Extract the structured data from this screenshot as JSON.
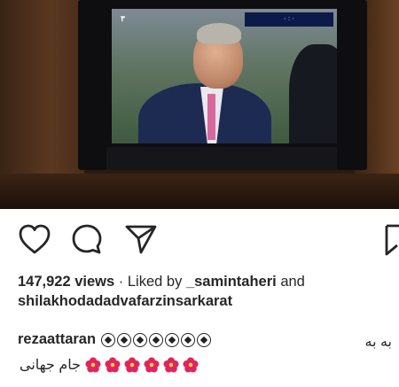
{
  "post": {
    "tv": {
      "channel_logo": "۳",
      "score": "۰ : ۰"
    },
    "actions": {
      "like_icon": "heart-icon",
      "comment_icon": "comment-icon",
      "share_icon": "share-icon",
      "save_icon": "bookmark-icon"
    },
    "views": "147,922 views",
    "liked_by_text": "Liked by",
    "liked_by_user": "_samintaheri",
    "and_text": "and",
    "likers": "shilakhodadadvafarzinsarkarat",
    "caption": {
      "username": "rezaattaran",
      "text_rtl": "به به",
      "ball_count": 7,
      "second_line_text": "جام جهانی",
      "flower_count": 6
    },
    "colors": {
      "text": "#262626",
      "tie": "#d7689b",
      "scorebar": "#0c1a4a"
    }
  }
}
